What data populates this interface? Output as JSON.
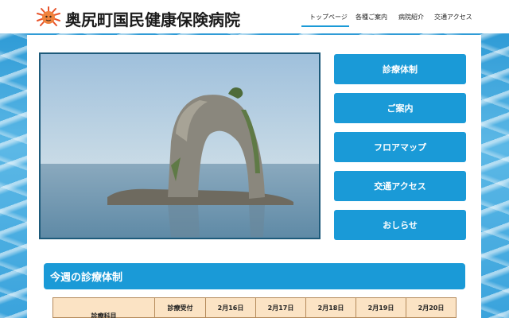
{
  "header": {
    "site_title": "奥尻町国民健康保険病院",
    "nav": [
      {
        "label": "トップページ"
      },
      {
        "label": "各種ご案内"
      },
      {
        "label": "病院紹介"
      },
      {
        "label": "交通アクセス"
      }
    ]
  },
  "hero": {
    "image": "rock-arch-photo"
  },
  "side_menu": [
    {
      "label": "診療体制"
    },
    {
      "label": "ご案内"
    },
    {
      "label": "フロアマップ"
    },
    {
      "label": "交通アクセス"
    },
    {
      "label": "おしらせ"
    }
  ],
  "weekly": {
    "title": "今週の診療体制",
    "headers": [
      "診療科目",
      "診療受付",
      "2月16日",
      "2月17日",
      "2月18日",
      "2月19日",
      "2月20日"
    ]
  },
  "colors": {
    "accent": "#1a9ad7",
    "table_bg": "#fbe3c4"
  }
}
